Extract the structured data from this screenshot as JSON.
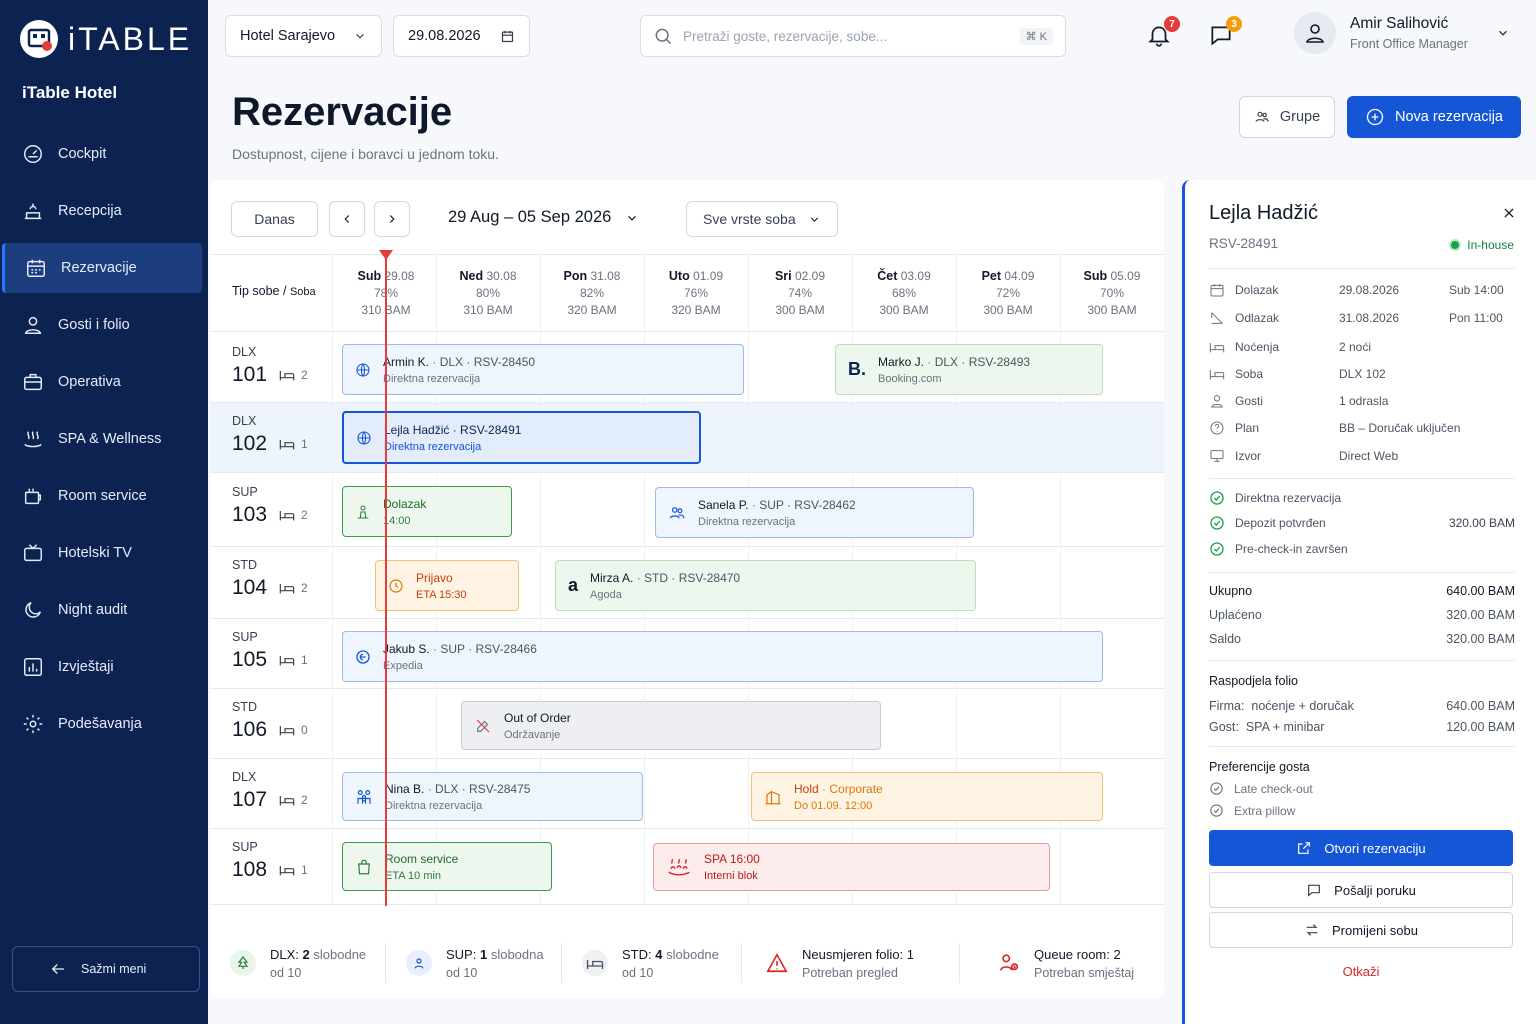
{
  "brand": {
    "wordmark": "iTABLE",
    "hotel": "iTable Hotel"
  },
  "nav": [
    {
      "label": "Cockpit",
      "icon": "gauge-icon"
    },
    {
      "label": "Recepcija",
      "icon": "reception-icon"
    },
    {
      "label": "Rezervacije",
      "icon": "calendar-icon",
      "active": true
    },
    {
      "label": "Gosti i folio",
      "icon": "user-icon"
    },
    {
      "label": "Operativa",
      "icon": "briefcase-icon"
    },
    {
      "label": "SPA & Wellness",
      "icon": "spa-icon"
    },
    {
      "label": "Room service",
      "icon": "room-service-icon"
    },
    {
      "label": "Hotelski TV",
      "icon": "tv-icon"
    },
    {
      "label": "Night audit",
      "icon": "moon-icon"
    },
    {
      "label": "Izvještaji",
      "icon": "chart-icon"
    },
    {
      "label": "Podešavanja",
      "icon": "gear-icon"
    }
  ],
  "collapse_label": "Sažmi meni",
  "topbar": {
    "hotel_select": "Hotel Sarajevo",
    "date": "29.08.2026",
    "search_placeholder": "Pretraži goste, rezervacije, sobe...",
    "shortcut": "⌘ K",
    "notifications": "7",
    "messages": "3",
    "user_name": "Amir Salihović",
    "user_role": "Front Office Manager"
  },
  "header": {
    "title": "Rezervacije",
    "subtitle": "Dostupnost, cijene i boravci u jednom toku.",
    "groups_btn": "Grupe",
    "new_btn": "Nova rezervacija"
  },
  "calendar": {
    "today_btn": "Danas",
    "range": "29 Aug – 05 Sep 2026",
    "room_filter": "Sve vrste soba",
    "col_head_type": "Tip sobe",
    "col_head_sep": "/",
    "col_head_room": "Soba",
    "days": [
      {
        "day": "Sub",
        "date": "29.08",
        "occ": "78%",
        "price": "310 BAM"
      },
      {
        "day": "Ned",
        "date": "30.08",
        "occ": "80%",
        "price": "310 BAM"
      },
      {
        "day": "Pon",
        "date": "31.08",
        "occ": "82%",
        "price": "320 BAM"
      },
      {
        "day": "Uto",
        "date": "01.09",
        "occ": "76%",
        "price": "320 BAM"
      },
      {
        "day": "Sri",
        "date": "02.09",
        "occ": "74%",
        "price": "300 BAM"
      },
      {
        "day": "Čet",
        "date": "03.09",
        "occ": "68%",
        "price": "300 BAM"
      },
      {
        "day": "Pet",
        "date": "04.09",
        "occ": "72%",
        "price": "300 BAM"
      },
      {
        "day": "Sub",
        "date": "05.09",
        "occ": "70%",
        "price": "300 BAM"
      }
    ],
    "rooms": [
      {
        "type": "DLX",
        "number": "101",
        "beds": "2"
      },
      {
        "type": "DLX",
        "number": "102",
        "beds": "1"
      },
      {
        "type": "SUP",
        "number": "103",
        "beds": "2"
      },
      {
        "type": "STD",
        "number": "104",
        "beds": "2"
      },
      {
        "type": "SUP",
        "number": "105",
        "beds": "1"
      },
      {
        "type": "STD",
        "number": "106",
        "beds": "0"
      },
      {
        "type": "DLX",
        "number": "107",
        "beds": "2"
      },
      {
        "type": "SUP",
        "number": "108",
        "beds": "1"
      }
    ],
    "bookings": {
      "armin": {
        "name": "Armin K.",
        "meta": "DLX · RSV-28450",
        "sub": "Direktna rezervacija"
      },
      "marko": {
        "name": "Marko J.",
        "meta": "DLX · RSV-28493",
        "sub": "Booking.com",
        "logo": "B."
      },
      "lejla": {
        "name": "Lejla Hadžić",
        "meta": "· RSV-28491",
        "sub": "Direktna rezervacija"
      },
      "dolazak": {
        "name": "Dolazak",
        "sub": "14:00"
      },
      "sanela": {
        "name": "Sanela P.",
        "meta": "SUP · RSV-28462",
        "sub": "Direktna rezervacija"
      },
      "prijavo": {
        "name": "Prijavo",
        "sub": "ETA 15:30"
      },
      "mirza": {
        "name": "Mirza A.",
        "meta": "STD · RSV-28470",
        "sub": "Agoda",
        "logo": "a"
      },
      "jakub": {
        "name": "Jakub S.",
        "meta": "SUP · RSV-28466",
        "sub": "Expedia"
      },
      "ooo": {
        "name": "Out of Order",
        "sub": "Održavanje"
      },
      "nina": {
        "name": "Nina B.",
        "meta": "DLX · RSV-28475",
        "sub": "Direktna rezervacija"
      },
      "hold": {
        "name": "Hold",
        "meta": "· Corporate",
        "sub": "Do 01.09. 12:00"
      },
      "roomservice": {
        "name": "Room service",
        "sub": "ETA 10 min"
      },
      "spa": {
        "name": "SPA",
        "meta": "16:00",
        "sub": "Interni blok"
      }
    },
    "summary": [
      {
        "l1a": "DLX:",
        "l1b": "2",
        "l1c": "slobodne",
        "l2": "od 10",
        "icon": "tree-icon"
      },
      {
        "l1a": "SUP:",
        "l1b": "1",
        "l1c": "slobodna",
        "l2": "od 10",
        "icon": "person-badge-icon"
      },
      {
        "l1a": "STD:",
        "l1b": "4",
        "l1c": "slobodne",
        "l2": "od 10",
        "icon": "bed-icon"
      },
      {
        "l1a": "Neusmjeren folio:",
        "l1b": "1",
        "l1c": "",
        "l2": "Potreban pregled",
        "icon": "warning-icon"
      },
      {
        "l1a": "Queue room:",
        "l1b": "2",
        "l1c": "",
        "l2": "Potreban smještaj",
        "icon": "queue-icon"
      }
    ]
  },
  "panel": {
    "name": "Lejla Hadžić",
    "id": "RSV-28491",
    "status": "In-house",
    "rows": [
      {
        "label": "Dolazak",
        "v1": "29.08.2026",
        "v2": "Sub 14:00",
        "icon": "calendar-icon"
      },
      {
        "label": "Odlazak",
        "v1": "31.08.2026",
        "v2": "Pon 11:00",
        "icon": "departure-icon"
      },
      {
        "label": "Noćenja",
        "v1": "2 noći",
        "v2": "",
        "icon": "bed-icon"
      },
      {
        "label": "Soba",
        "v1": "DLX 102",
        "v2": "",
        "icon": "bed-icon"
      },
      {
        "label": "Gosti",
        "v1": "1 odrasla",
        "v2": "",
        "icon": "user-icon"
      },
      {
        "label": "Plan",
        "v1": "BB – Doručak uključen",
        "v2": "",
        "icon": "help-icon"
      },
      {
        "label": "Izvor",
        "v1": "Direct Web",
        "v2": "",
        "icon": "monitor-icon"
      }
    ],
    "checks": [
      {
        "label": "Direktna rezervacija",
        "amount": ""
      },
      {
        "label": "Depozit potvrđen",
        "amount": "320.00 BAM"
      },
      {
        "label": "Pre-check-in završen",
        "amount": ""
      }
    ],
    "totals": [
      {
        "label": "Ukupno",
        "value": "640.00 BAM"
      },
      {
        "label": "Uplaćeno",
        "value": "320.00 BAM"
      },
      {
        "label": "Saldo",
        "value": "320.00 BAM"
      }
    ],
    "folio_title": "Raspodjela folio",
    "folio": [
      {
        "who": "Firma:",
        "what": "noćenje + doručak",
        "value": "640.00 BAM"
      },
      {
        "who": "Gost:",
        "what": "SPA + minibar",
        "value": "120.00 BAM"
      }
    ],
    "pref_title": "Preferencije gosta",
    "prefs": [
      "Late check-out",
      "Extra pillow"
    ],
    "open_btn": "Otvori rezervaciju",
    "message_btn": "Pošalji poruku",
    "change_room_btn": "Promijeni sobu",
    "cancel": "Otkaži"
  },
  "colors": {
    "sidebar": "#0c2352",
    "primary": "#1556d6",
    "today": "#e63b3b",
    "success": "#15803d"
  }
}
